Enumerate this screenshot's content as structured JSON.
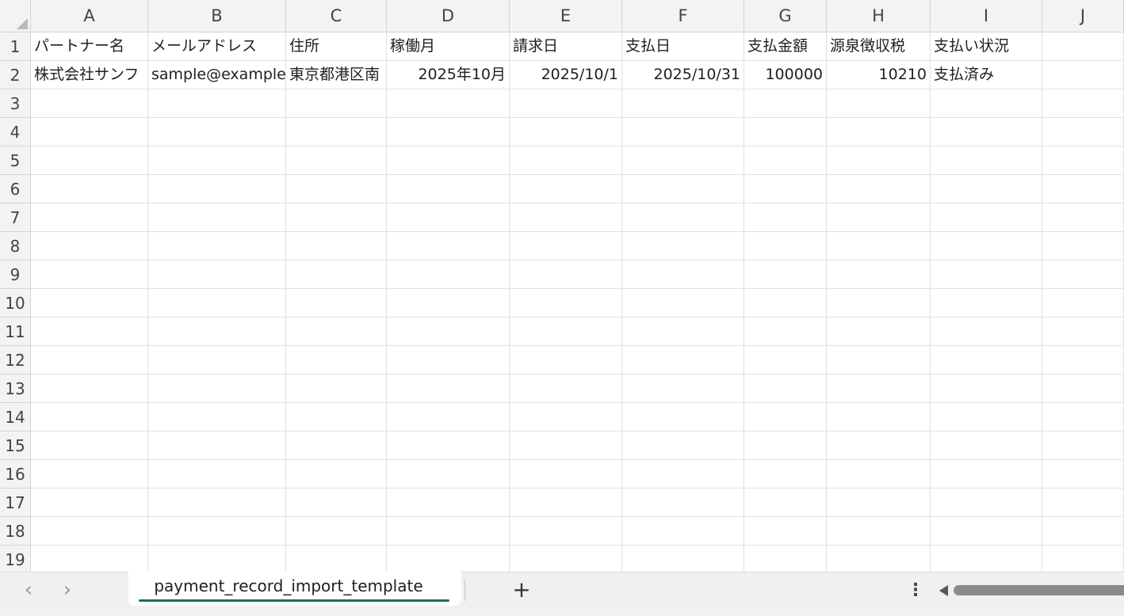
{
  "columns": [
    "A",
    "B",
    "C",
    "D",
    "E",
    "F",
    "G",
    "H",
    "I",
    "J"
  ],
  "rows": [
    "1",
    "2",
    "3",
    "4",
    "5",
    "6",
    "7",
    "8",
    "9",
    "10",
    "11",
    "12",
    "13",
    "14",
    "15",
    "16",
    "17",
    "18",
    "19"
  ],
  "cells": {
    "header": [
      "パートナー名",
      "メールアドレス",
      "住所",
      "稼働月",
      "請求日",
      "支払日",
      "支払金額",
      "源泉徴収税",
      "支払い状況"
    ],
    "row2": [
      "株式会社サンフ",
      "sample@example",
      "東京都港区南",
      "2025年10月",
      "2025/10/1",
      "2025/10/31",
      "100000",
      "10210",
      "支払済み"
    ]
  },
  "sheet_tab": {
    "name": "payment_record_import_template",
    "active_color": "#1e7145"
  },
  "icons": {
    "prev": "chevron-left-icon",
    "next": "chevron-right-icon",
    "add": "plus-icon",
    "more": "more-vertical-icon"
  },
  "glyphs": {
    "prev": "‹",
    "next": "›",
    "add": "+",
    "more": "⋮"
  }
}
